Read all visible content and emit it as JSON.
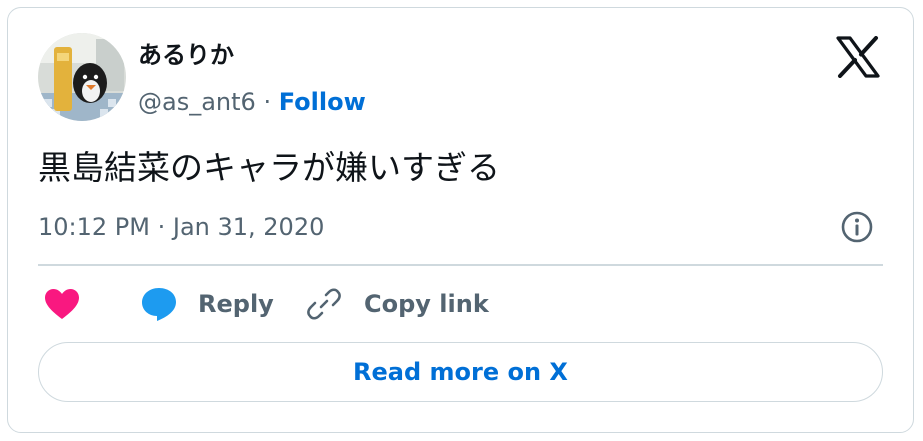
{
  "author": {
    "display_name": "あるりか",
    "handle": "@as_ant6",
    "separator": "·",
    "follow_label": "Follow"
  },
  "tweet": {
    "text": "黒島結菜のキャラが嫌いすぎる",
    "timestamp": "10:12 PM · Jan 31, 2020"
  },
  "actions": {
    "reply_label": "Reply",
    "copy_link_label": "Copy link"
  },
  "read_more_label": "Read more on X",
  "colors": {
    "accent": "#006fd6",
    "like": "#f91880",
    "reply_icon": "#1d9bf0",
    "muted": "#536471",
    "border": "#cfd9de"
  },
  "icons": [
    "x-logo-icon",
    "info-icon",
    "heart-icon",
    "speech-bubble-icon",
    "link-icon"
  ]
}
